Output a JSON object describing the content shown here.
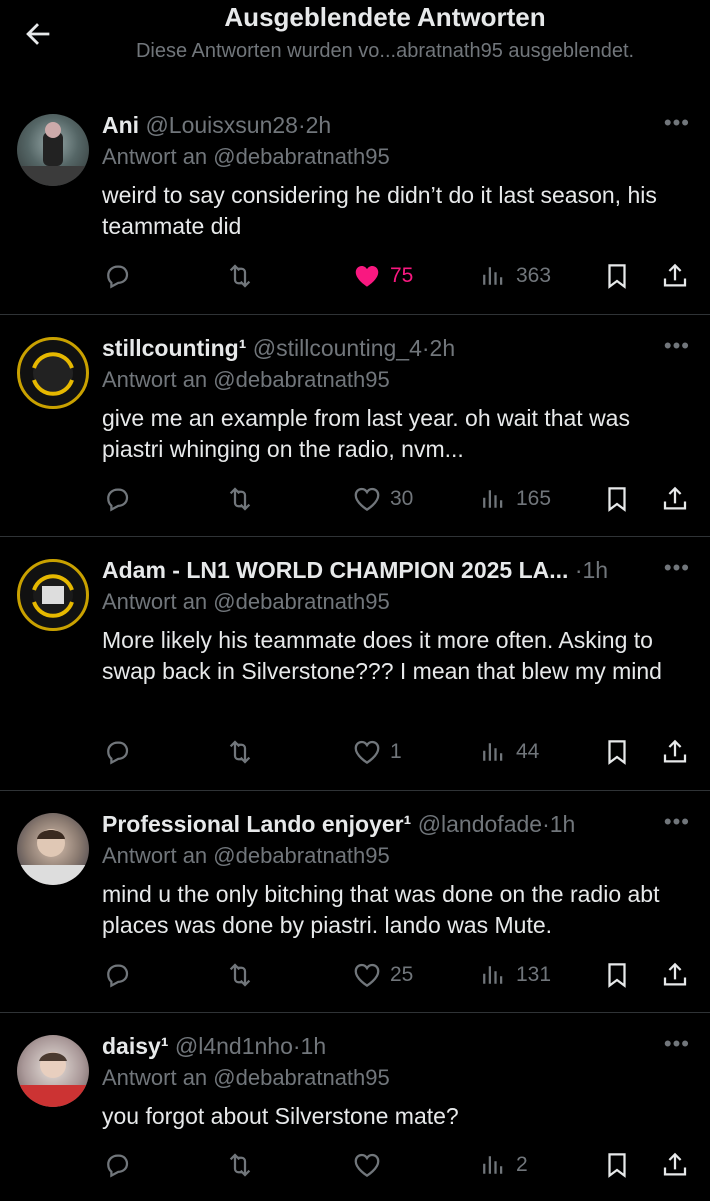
{
  "header": {
    "title": "Ausgeblendete Antworten",
    "subtitle": "Diese Antworten wurden vo...abratnath95 ausgeblendet."
  },
  "tweets": [
    {
      "name": "Ani",
      "handle": "@Louisxsun28",
      "time": "2h",
      "reply_to": "Antwort an @debabratnath95",
      "text": "weird to say considering he didn’t do it last season, his teammate did",
      "likes": "75",
      "liked": true,
      "views": "363"
    },
    {
      "name": "stillcounting¹",
      "handle": "@stillcounting_4",
      "time": "2h",
      "reply_to": "Antwort an @debabratnath95",
      "text": "give me an example from last year. oh wait that was piastri whinging on the radio, nvm...",
      "likes": "30",
      "liked": false,
      "views": "165"
    },
    {
      "name": "Adam - LN1 WORLD CHAMPION 2025 LA...",
      "handle": "",
      "time": "1h",
      "reply_to": "Antwort an @debabratnath95",
      "text": "More likely his teammate does it more often. Asking to swap back in Silverstone??? I mean that blew my mind",
      "likes": "1",
      "liked": false,
      "views": "44"
    },
    {
      "name": "Professional Lando enjoyer¹",
      "handle": "@landofade",
      "time": "1h",
      "reply_to": "Antwort an @debabratnath95",
      "text": "mind u the only bitching that was done on the radio abt places was done by piastri. lando was Mute.",
      "likes": "25",
      "liked": false,
      "views": "131"
    },
    {
      "name": "daisy¹",
      "handle": "@l4nd1nho",
      "time": "1h",
      "reply_to": "Antwort an @debabratnath95",
      "text": "you forgot about Silverstone mate?",
      "likes": "",
      "liked": false,
      "views": "2"
    }
  ],
  "dot": "·",
  "icons": {
    "back": "arrow-left-icon",
    "more": "more-dots-icon",
    "reply": "reply-bubble-icon",
    "retweet": "retweet-icon",
    "like": "heart-icon",
    "views": "views-bar-icon",
    "bookmark": "bookmark-icon",
    "share": "share-upload-icon"
  },
  "colors": {
    "background": "#000000",
    "text": "#e7e9ea",
    "muted": "#71767b",
    "like": "#f91880",
    "divider": "#2f3336"
  }
}
